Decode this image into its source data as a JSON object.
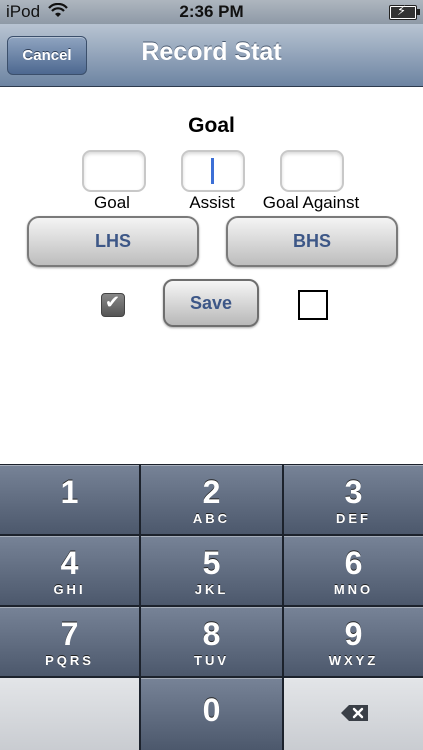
{
  "status_bar": {
    "carrier": "iPod",
    "time": "2:36 PM"
  },
  "nav_bar": {
    "title": "Record Stat",
    "cancel_label": "Cancel"
  },
  "form": {
    "heading": "Goal",
    "fields": [
      {
        "label": "Goal",
        "value": ""
      },
      {
        "label": "Assist",
        "value": ""
      },
      {
        "label": "Goal Against",
        "value": ""
      }
    ],
    "team_buttons": [
      "LHS",
      "BHS"
    ],
    "save_label": "Save",
    "checkbox_left_checked": true,
    "checkbox_right_checked": false
  },
  "keypad": [
    {
      "num": "1",
      "letters": ""
    },
    {
      "num": "2",
      "letters": "ABC"
    },
    {
      "num": "3",
      "letters": "DEF"
    },
    {
      "num": "4",
      "letters": "GHI"
    },
    {
      "num": "5",
      "letters": "JKL"
    },
    {
      "num": "6",
      "letters": "MNO"
    },
    {
      "num": "7",
      "letters": "PQRS"
    },
    {
      "num": "8",
      "letters": "TUV"
    },
    {
      "num": "9",
      "letters": "WXYZ"
    },
    {
      "num": "0",
      "letters": ""
    }
  ]
}
